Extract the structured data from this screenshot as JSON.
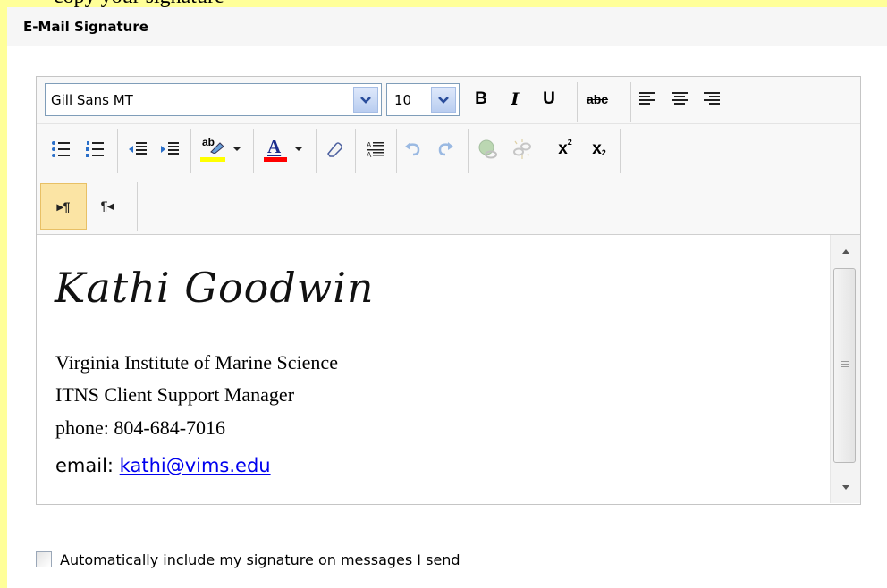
{
  "top_strip_text": "copy your signature",
  "header": {
    "title": "E-Mail Signature"
  },
  "toolbar": {
    "font_name": "Gill Sans MT",
    "font_size": "10",
    "buttons": {
      "bold": "B",
      "italic": "I",
      "underline": "U",
      "strikethrough": "abc",
      "font_color_letter": "A",
      "superscript_base": "x",
      "superscript_exp": "2",
      "subscript_base": "x",
      "subscript_exp": "2",
      "ltr": "▸¶",
      "rtl": "¶◂",
      "highlight_label": "ab"
    }
  },
  "signature": {
    "name": "Kathi Goodwin",
    "line1": "Virginia Institute of Marine Science",
    "line2": "ITNS Client Support Manager",
    "line3": "phone: 804-684-7016",
    "email_label": "email: ",
    "email_link": "kathi@vims.edu"
  },
  "auto_include": {
    "label": "Automatically include my signature on messages I send",
    "checked": false
  },
  "colors": {
    "highlight_bar": "#ffff00",
    "font_color_bar": "#ff0000",
    "active_button": "#fbe4a4",
    "link": "#0000ee"
  }
}
